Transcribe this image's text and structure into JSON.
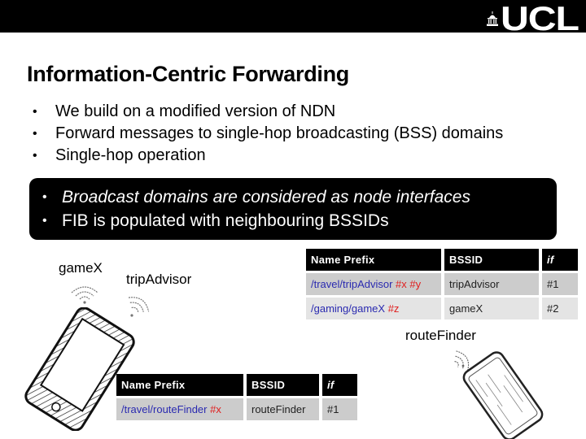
{
  "header": {
    "logo_text": "UCL",
    "logo_icon": "portico-dome-icon"
  },
  "slide": {
    "title": "Information-Centric Forwarding",
    "bullets": [
      "We build on a modified version of NDN",
      "Forward messages to single-hop broadcasting (BSS) domains",
      "Single-hop operation"
    ],
    "callout": [
      {
        "text": "Broadcast domains are considered as node interfaces",
        "italic": true
      },
      {
        "text": "FIB is populated with neighbouring BSSIDs",
        "italic": false
      }
    ],
    "bullet_glyph": "•"
  },
  "nodes": {
    "gamex": {
      "label": "gameX",
      "icon": "wifi-signal-icon"
    },
    "tripadvisor": {
      "label": "tripAdvisor",
      "icon": "wifi-signal-icon"
    },
    "routefinder": {
      "label": "routeFinder",
      "icon": "wifi-signal-icon"
    },
    "device_icon": "smartphone-icon"
  },
  "fib_tables": {
    "gamex_table": {
      "headers": [
        "Name Prefix",
        "BSSID",
        "if"
      ],
      "rows": [
        {
          "prefix": "/travel/tripAdvisor",
          "tags": "#x #y",
          "bssid": "tripAdvisor",
          "if": "#1"
        },
        {
          "prefix": "/gaming/gameX",
          "tags": "#z",
          "bssid": "gameX",
          "if": "#2"
        }
      ]
    },
    "routefinder_table": {
      "headers": [
        "Name Prefix",
        "BSSID",
        "if"
      ],
      "rows": [
        {
          "prefix": "/travel/routeFinder",
          "tags": "#x",
          "bssid": "routeFinder",
          "if": "#1"
        }
      ]
    }
  },
  "colors": {
    "header_bg": "#000000",
    "prefix_text": "#2a2ab0",
    "tag_text": "#e02020",
    "row_dark": "#cccccc",
    "row_light": "#e4e4e4"
  }
}
